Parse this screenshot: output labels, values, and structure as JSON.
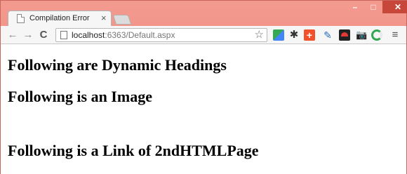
{
  "browser": {
    "tab_title": "Compilation Error",
    "tab_close": "×",
    "url_host": "localhost",
    "url_rest": ":6363/Default.aspx",
    "back_icon": "←",
    "forward_icon": "→",
    "reload_icon": "C",
    "star_icon": "☆",
    "menu_icon": "≡",
    "window_controls": {
      "minimize": "–",
      "maximize": "□",
      "close": "✕"
    },
    "extensions": {
      "ext2": "✱",
      "ext3": "+",
      "ext4": "✎",
      "ext6": "📷"
    },
    "colors": {
      "frame": "#f08a7e",
      "close_button": "#c7473b"
    }
  },
  "page": {
    "headings": [
      "Following are Dynamic Headings",
      "Following is an Image",
      "Following is a Link of 2ndHTMLPage"
    ]
  }
}
